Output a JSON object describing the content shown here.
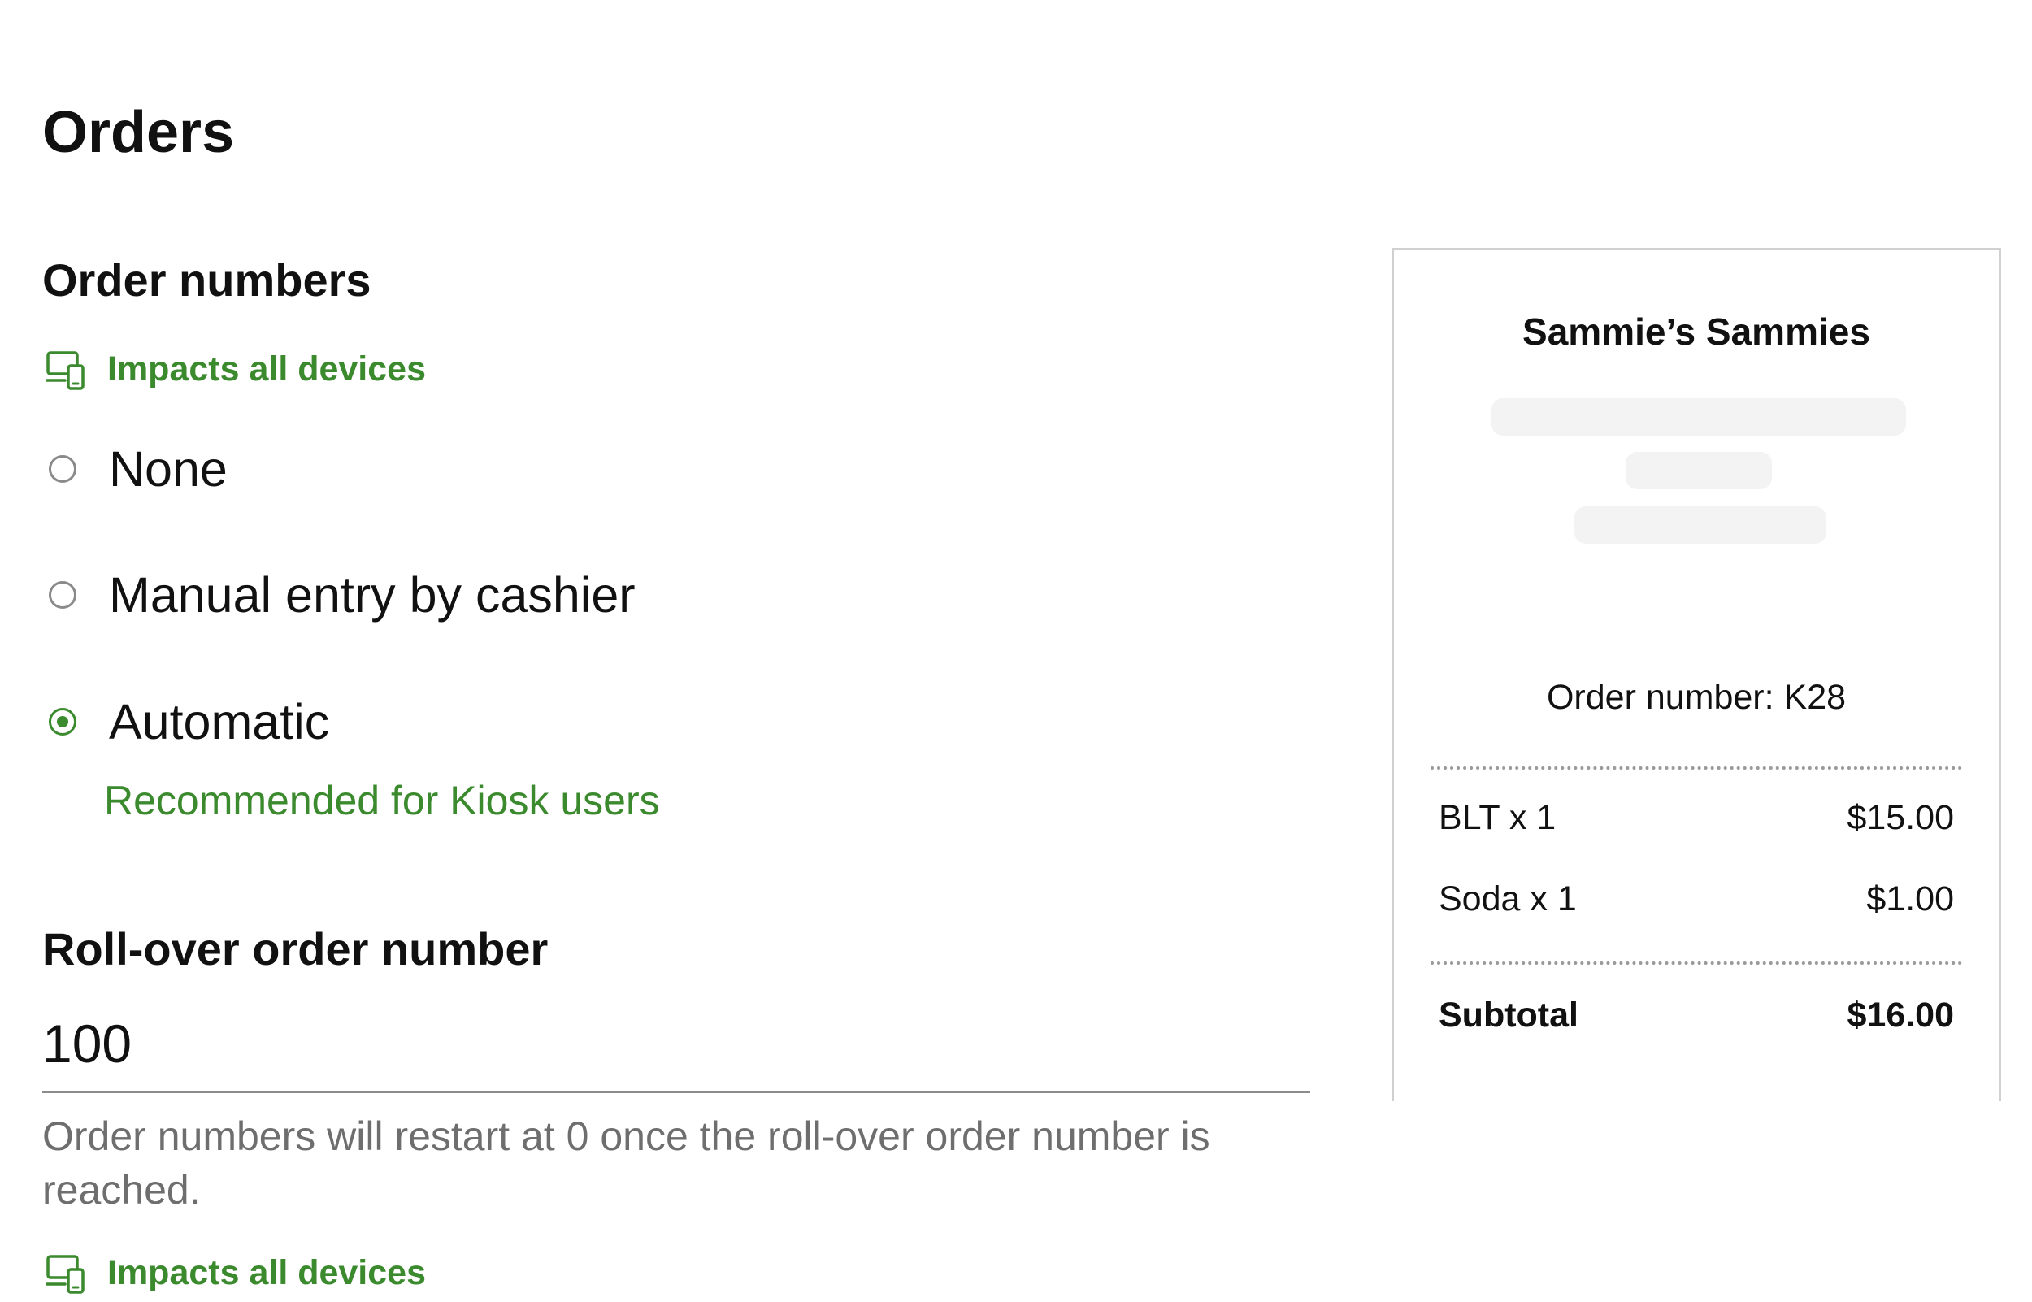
{
  "page": {
    "title": "Orders"
  },
  "order_numbers": {
    "title": "Order numbers",
    "impact_label": "Impacts all devices",
    "options": [
      {
        "label": "None",
        "selected": false
      },
      {
        "label": "Manual entry by cashier",
        "selected": false
      },
      {
        "label": "Automatic",
        "selected": true
      }
    ],
    "automatic_note": "Recommended for Kiosk users"
  },
  "rollover": {
    "title": "Roll-over order number",
    "value": "100",
    "helper": "Order numbers will restart at 0 once the roll-over order number is reached.",
    "impact_label": "Impacts all devices"
  },
  "receipt": {
    "store_name": "Sammie’s Sammies",
    "order_number": "Order number: K28",
    "items": [
      {
        "name": "BLT x 1",
        "price": "$15.00"
      },
      {
        "name": "Soda x 1",
        "price": "$1.00"
      }
    ],
    "subtotal_label": "Subtotal",
    "subtotal_value": "$16.00"
  },
  "colors": {
    "accent": "#3b8a2e",
    "helper_text": "#6e6e6e",
    "divider": "#8c8c8c"
  },
  "icons": {
    "impact": "devices-icon"
  }
}
